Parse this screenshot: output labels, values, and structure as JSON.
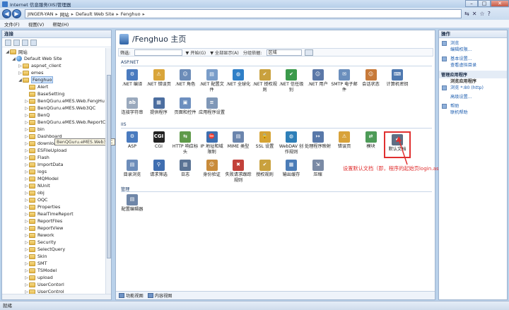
{
  "window": {
    "title": "Internet 信息服务(IIS)管理器",
    "minimize": "–",
    "maximize": "□",
    "close": "✕"
  },
  "address": {
    "back": "◀",
    "forward": "▶",
    "crumbs": [
      "JINGER-YAN",
      "网站",
      "Default Web Site",
      "Fenghuo"
    ],
    "sep": "▸",
    "tools": [
      "⇆",
      "✕",
      "☆",
      "?"
    ]
  },
  "menu": [
    "文件(F)",
    "视图(V)",
    "帮助(H)"
  ],
  "left": {
    "header": "连接",
    "tree": [
      {
        "label": "网站",
        "exp": "◢",
        "icon": "folder",
        "indent": 0
      },
      {
        "label": "Default Web Site",
        "exp": "◢",
        "icon": "globe",
        "indent": 1
      },
      {
        "label": "aspnet_client",
        "exp": "▷",
        "icon": "folder",
        "indent": 2
      },
      {
        "label": "emes",
        "exp": "▷",
        "icon": "folder",
        "indent": 2
      },
      {
        "label": "Fenghuo",
        "exp": "◢",
        "icon": "folder",
        "indent": 2,
        "selected": true
      },
      {
        "label": "Alert",
        "exp": "",
        "icon": "folder",
        "indent": 3
      },
      {
        "label": "BaseSetting",
        "exp": "",
        "icon": "folder",
        "indent": 3
      },
      {
        "label": "BenQGuru.eMES.Web.FengHu",
        "exp": "▷",
        "icon": "folder",
        "indent": 3
      },
      {
        "label": "BenQGuru.eMES.Web3QC",
        "exp": "▷",
        "icon": "folder",
        "indent": 3
      },
      {
        "label": "BenQ",
        "exp": "▷",
        "icon": "folder",
        "indent": 3
      },
      {
        "label": "BenQGuru.eMES.Web.ReportCenter",
        "exp": "▷",
        "icon": "folder",
        "indent": 3
      },
      {
        "label": "bin",
        "exp": "▷",
        "icon": "folder",
        "indent": 3
      },
      {
        "label": "Dashboard",
        "exp": "▷",
        "icon": "folder",
        "indent": 3
      },
      {
        "label": "download",
        "exp": "▷",
        "icon": "folder",
        "indent": 3
      },
      {
        "label": "ESFileUpload",
        "exp": "▷",
        "icon": "folder",
        "indent": 3
      },
      {
        "label": "Flash",
        "exp": "▷",
        "icon": "folder",
        "indent": 3
      },
      {
        "label": "ImportData",
        "exp": "▷",
        "icon": "folder",
        "indent": 3
      },
      {
        "label": "logs",
        "exp": "▷",
        "icon": "folder",
        "indent": 3
      },
      {
        "label": "MQModel",
        "exp": "▷",
        "icon": "folder",
        "indent": 3
      },
      {
        "label": "NUnit",
        "exp": "▷",
        "icon": "folder",
        "indent": 3
      },
      {
        "label": "obj",
        "exp": "▷",
        "icon": "folder",
        "indent": 3
      },
      {
        "label": "OQC",
        "exp": "▷",
        "icon": "folder",
        "indent": 3
      },
      {
        "label": "Properties",
        "exp": "▷",
        "icon": "folder",
        "indent": 3
      },
      {
        "label": "RealTimeReport",
        "exp": "▷",
        "icon": "folder",
        "indent": 3
      },
      {
        "label": "ReportFiles",
        "exp": "▷",
        "icon": "folder",
        "indent": 3
      },
      {
        "label": "ReportView",
        "exp": "▷",
        "icon": "folder",
        "indent": 3
      },
      {
        "label": "Rework",
        "exp": "▷",
        "icon": "folder",
        "indent": 3
      },
      {
        "label": "Security",
        "exp": "▷",
        "icon": "folder",
        "indent": 3
      },
      {
        "label": "SelectQuery",
        "exp": "▷",
        "icon": "folder",
        "indent": 3
      },
      {
        "label": "Skin",
        "exp": "▷",
        "icon": "folder",
        "indent": 3
      },
      {
        "label": "SMT",
        "exp": "▷",
        "icon": "folder",
        "indent": 3
      },
      {
        "label": "TSModel",
        "exp": "▷",
        "icon": "folder",
        "indent": 3
      },
      {
        "label": "upload",
        "exp": "▷",
        "icon": "folder",
        "indent": 3
      },
      {
        "label": "UserContorl",
        "exp": "▷",
        "icon": "folder",
        "indent": 3
      },
      {
        "label": "UserControl",
        "exp": "▷",
        "icon": "folder",
        "indent": 3
      }
    ],
    "tooltip": "BenQGuru.eMES.Web3QC"
  },
  "center": {
    "title": "/Fenghuo 主页",
    "filter_label": "筛选:",
    "start_btn": "▼ 开始(G)",
    "showall_btn": "▼ 全部显示(A)",
    "group_label": "分组依据:",
    "group_value": "区域",
    "sections": [
      "ASP.NET",
      "IIS",
      "管理"
    ],
    "aspnet": [
      {
        "label": ".NET 编译",
        "color": "#4a7bbf",
        "glyph": "⚙"
      },
      {
        "label": ".NET 错误页",
        "color": "#d9a53a",
        "glyph": "⚠"
      },
      {
        "label": ".NET 角色",
        "color": "#6c8cb8",
        "glyph": "☺"
      },
      {
        "label": ".NET 配置文件",
        "color": "#7a9dc9",
        "glyph": "▤"
      },
      {
        "label": ".NET 全球化",
        "color": "#2f7fc7",
        "glyph": "◍"
      },
      {
        "label": ".NET 授权规则",
        "color": "#c9a13e",
        "glyph": "✔"
      },
      {
        "label": ".NET 信任级别",
        "color": "#3b9a4b",
        "glyph": "✔"
      },
      {
        "label": ".NET 用户",
        "color": "#5b78a8",
        "glyph": "☺"
      },
      {
        "label": "SMTP 电子邮件",
        "color": "#6b8fbd",
        "glyph": "✉"
      },
      {
        "label": "会话状态",
        "color": "#c77a3a",
        "glyph": "☺"
      },
      {
        "label": "计算机密钥",
        "color": "#4f79b0",
        "glyph": "⌨"
      },
      {
        "label": "连接字符串",
        "color": "#9aa9bd",
        "glyph": "ab"
      },
      {
        "label": "提供程序",
        "color": "#4c6ea0",
        "glyph": "▦"
      },
      {
        "label": "页面和控件",
        "color": "#6d8fbf",
        "glyph": "▣"
      },
      {
        "label": "应用程序设置",
        "color": "#7f97b7",
        "glyph": "≡"
      }
    ],
    "iis": [
      {
        "label": "ASP",
        "color": "#4a7bbf",
        "glyph": "⚙"
      },
      {
        "label": "CGI",
        "color": "#222222",
        "glyph": "CGI"
      },
      {
        "label": "HTTP 响应标头",
        "color": "#5f9a4a",
        "glyph": "⇆"
      },
      {
        "label": "IP 地址和域限制",
        "color": "#3d6fb0",
        "glyph": "⛔"
      },
      {
        "label": "MIME 类型",
        "color": "#6b85ad",
        "glyph": "▤"
      },
      {
        "label": "SSL 设置",
        "color": "#d5a334",
        "glyph": "🔒"
      },
      {
        "label": "WebDAV 创作规则",
        "color": "#2e7fb8",
        "glyph": "◍"
      },
      {
        "label": "处理程序映射",
        "color": "#5878a9",
        "glyph": "↦"
      },
      {
        "label": "错误页",
        "color": "#d8a23a",
        "glyph": "⚠"
      },
      {
        "label": "模块",
        "color": "#4d9b57",
        "glyph": "⇄"
      },
      {
        "label": "默认文档",
        "color": "#5e6e84",
        "glyph": "✔"
      },
      {
        "label": "目录浏览",
        "color": "#6d8dba",
        "glyph": "▤"
      },
      {
        "label": "请求筛选",
        "color": "#3f6eb0",
        "glyph": "⚲"
      },
      {
        "label": "日志",
        "color": "#5a7394",
        "glyph": "▥"
      },
      {
        "label": "身份验证",
        "color": "#c98b3a",
        "glyph": "☺"
      },
      {
        "label": "失败请求跟踪规则",
        "color": "#c2413a",
        "glyph": "✖"
      },
      {
        "label": "授权规则",
        "color": "#c9a13e",
        "glyph": "✔"
      },
      {
        "label": "输出缓存",
        "color": "#4b7cb7",
        "glyph": "▦"
      },
      {
        "label": "压缩",
        "color": "#7a8aa5",
        "glyph": "⇲"
      }
    ],
    "mgmt": [
      {
        "label": "配置编辑器",
        "color": "#6f86a8",
        "glyph": "▤"
      }
    ],
    "annotation": "设置默认文档（即，程序的起始页login.aspx）",
    "tab_features": "功能视图",
    "tab_content": "内容视图"
  },
  "right": {
    "header": "操作",
    "actions1": [
      "浏览",
      "编辑权限..."
    ],
    "actions2": [
      "基本设置...",
      "查看虚拟目录"
    ],
    "sub1": "管理应用程序",
    "sub2": "浏览应用程序",
    "actions3": [
      "浏览 *:80 (http)"
    ],
    "actions4": [
      "高级设置..."
    ],
    "actions5": [
      "帮助",
      "联机帮助"
    ]
  },
  "status": "就绪"
}
